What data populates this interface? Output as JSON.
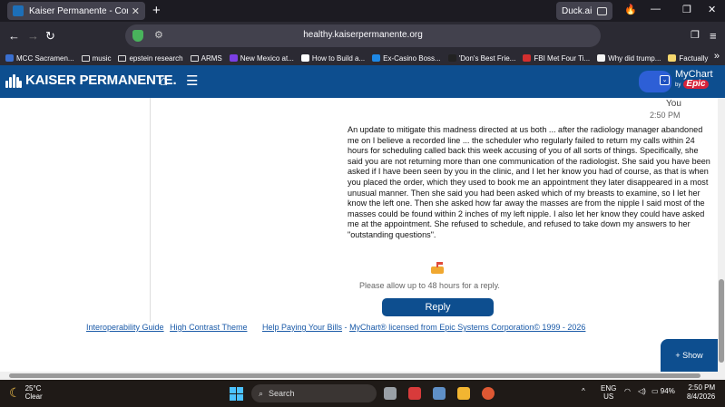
{
  "browser": {
    "tab_title": "Kaiser Permanente - Conversa",
    "tab_close": "✕",
    "new_tab": "+",
    "duckai_label": "Duck.ai",
    "url": "healthy.kaiserpermanente.org",
    "window_min": "—",
    "window_restore": "❐",
    "window_close": "✕",
    "back": "←",
    "forward": "→",
    "reload": "↻",
    "bookmarks": [
      "MCC Sacramen...",
      "music",
      "epstein research",
      "ARMS",
      "New Mexico at...",
      "How to Build a...",
      "Ex-Casino Boss...",
      "'Don's Best Frie...",
      "FBI Met Four Ti...",
      "Why did trump...",
      "Factually"
    ],
    "bookmarks_more": "»"
  },
  "header": {
    "logo_text": "KAISER PERMANENTE.",
    "home_icon": "⌂",
    "menu_icon": "☰",
    "avatar_chevron": "⌄",
    "mychart_line1": "MyChart",
    "mychart_by": "by",
    "mychart_epic": "Epic"
  },
  "message": {
    "sender": "You",
    "time": "2:50 PM",
    "body": "An update to mitigate this madness directed at us both ... after the radiology manager abandoned me on I believe a recorded line ... the scheduler who regularly failed to return my calls within 24 hours for scheduling called back this week accusing of you of all sorts of things. Specifically, she said you are not returning more than one communication of the radiologist. She said you have been asked if I have been seen by you in the clinic, and I let her know you had of course, as that is when you placed the order, which they used to book me an appointment they later disappeared in a most unusual manner. Then she said you had been asked which of my breasts to examine, so I let her know the left one. Then she asked how far away the masses are from the nipple I said most of the masses could be found within 2 inches of my left nipple. I also let her know they could have asked me at the appointment. She refused to schedule, and refused to take down my answers to her \"outstanding questions\".",
    "allow_text": "Please allow up to 48 hours for a reply.",
    "reply_label": "Reply"
  },
  "footer": {
    "link1": "Interoperability Guide",
    "link2": "High Contrast Theme",
    "link3": "Help Paying Your Bills",
    "separator": "-",
    "link4": "MyChart® licensed from Epic Systems Corporation© 1999 - 2026"
  },
  "show_label": "+ Show",
  "taskbar": {
    "temp": "25°C",
    "condition": "Clear",
    "search_label": "Search",
    "lang_line1": "ENG",
    "lang_line2": "US",
    "battery": "94%",
    "time": "2:50 PM",
    "date": "8/4/2026",
    "tray_chevron": "^"
  },
  "colors": {
    "kp_blue": "#0d4e8f",
    "epic_red": "#d6223a",
    "link_blue": "#1a5aa8"
  }
}
